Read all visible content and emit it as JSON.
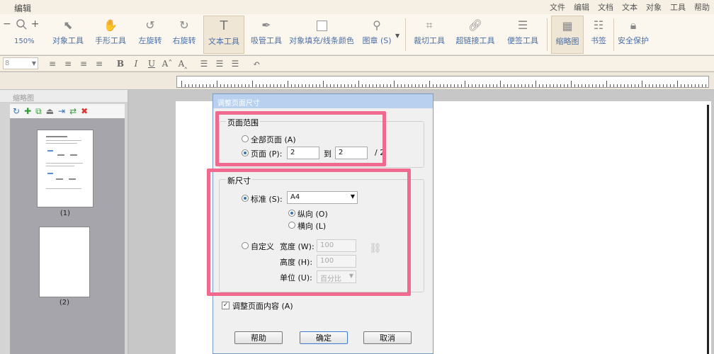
{
  "app": {
    "title": "编辑"
  },
  "menu": [
    "文件",
    "编辑",
    "文档",
    "文本",
    "对象",
    "工具",
    "帮助"
  ],
  "toolbar": {
    "zoom_out": "−",
    "zoom_in": "+",
    "zoom_level": "150%",
    "tools": [
      {
        "label": "对象工具",
        "icon": "arrow-cursor-icon"
      },
      {
        "label": "手形工具",
        "icon": "hand-icon"
      },
      {
        "label": "左旋转",
        "icon": "rotate-left-icon"
      },
      {
        "label": "右旋转",
        "icon": "rotate-right-icon"
      },
      {
        "label": "文本工具",
        "icon": "text-tool-icon"
      },
      {
        "label": "吸管工具",
        "icon": "eyedropper-icon"
      },
      {
        "label": "对象填充/线条颜色",
        "icon": "fill-color-icon"
      },
      {
        "label": "图章 (S)",
        "icon": "stamp-icon"
      },
      {
        "label": "裁切工具",
        "icon": "crop-icon"
      },
      {
        "label": "超链接工具",
        "icon": "link-icon"
      },
      {
        "label": "便签工具",
        "icon": "note-icon"
      },
      {
        "label": "缩略图",
        "icon": "thumbnail-icon"
      },
      {
        "label": "书签",
        "icon": "bookmark-icon"
      },
      {
        "label": "安全保护",
        "icon": "lock-icon"
      }
    ]
  },
  "format": {
    "font_size": "8"
  },
  "left_panel": {
    "title": "缩略图",
    "pages": [
      "(1)",
      "(2)"
    ]
  },
  "dialog": {
    "title": "调整页面尺寸",
    "page_range": {
      "group_title": "页面范围",
      "all_pages": "全部页面 (A)",
      "pages_label": "页面 (P):",
      "from": "2",
      "to_label": "到",
      "to": "2",
      "total": "/ 2",
      "selected": "pages"
    },
    "new_size": {
      "group_title": "新尺寸",
      "standard_label": "标准 (S):",
      "standard_value": "A4",
      "portrait": "纵向 (O)",
      "landscape": "横向 (L)",
      "orientation": "portrait",
      "custom_label": "自定义",
      "width_label": "宽度 (W):",
      "width_value": "100",
      "height_label": "高度 (H):",
      "height_value": "100",
      "unit_label": "单位 (U):",
      "unit_value": "百分比"
    },
    "adjust_content": {
      "label": "调整页面内容 (A)",
      "checked": true
    },
    "buttons": {
      "help": "帮助",
      "ok": "确定",
      "cancel": "取消"
    }
  },
  "colors": {
    "highlight": "#f06a8f",
    "title_bar": "#b9d1ee",
    "accent": "#4a6fa5"
  }
}
